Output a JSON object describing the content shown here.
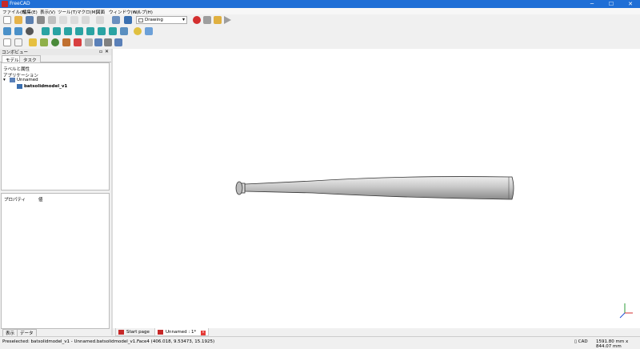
{
  "window": {
    "title": "FreeCAD",
    "minimize": "─",
    "maximize": "☐",
    "close": "✕"
  },
  "menu": [
    "ファイル(F)",
    "編集(E)",
    "表示(V)",
    "ツール(T)",
    "マクロ(M)",
    "図面",
    "ウィンドウ(W)",
    "ヘルプ(H)"
  ],
  "toolbar": {
    "workbench": "Drawing"
  },
  "combo_view": {
    "title": "コンボビュー",
    "tabs": [
      "モデル",
      "タスク"
    ],
    "tree_header": "ラベルと属性",
    "tree_root": "アプリケーション",
    "document": "Unnamed",
    "object": "batsolidmodel_v1",
    "prop_col1": "プロパティ",
    "prop_col2": "値",
    "bottom_tabs": [
      "表示",
      "データ"
    ]
  },
  "doc_tabs": [
    "Start page",
    "Unnamed : 1*"
  ],
  "status": {
    "message": "Preselected: batsolidmodel_v1 - Unnamed.batsolidmodel_v1.Face4 (406.018, 9.53473, 15.1925)",
    "nav_style": "CAD",
    "dimensions": "1591.80 mm x 844.07 mm"
  },
  "colors": {
    "titlebar": "#1f6fd6",
    "record": "#d32f2f",
    "bat": "#c8c8c8"
  }
}
